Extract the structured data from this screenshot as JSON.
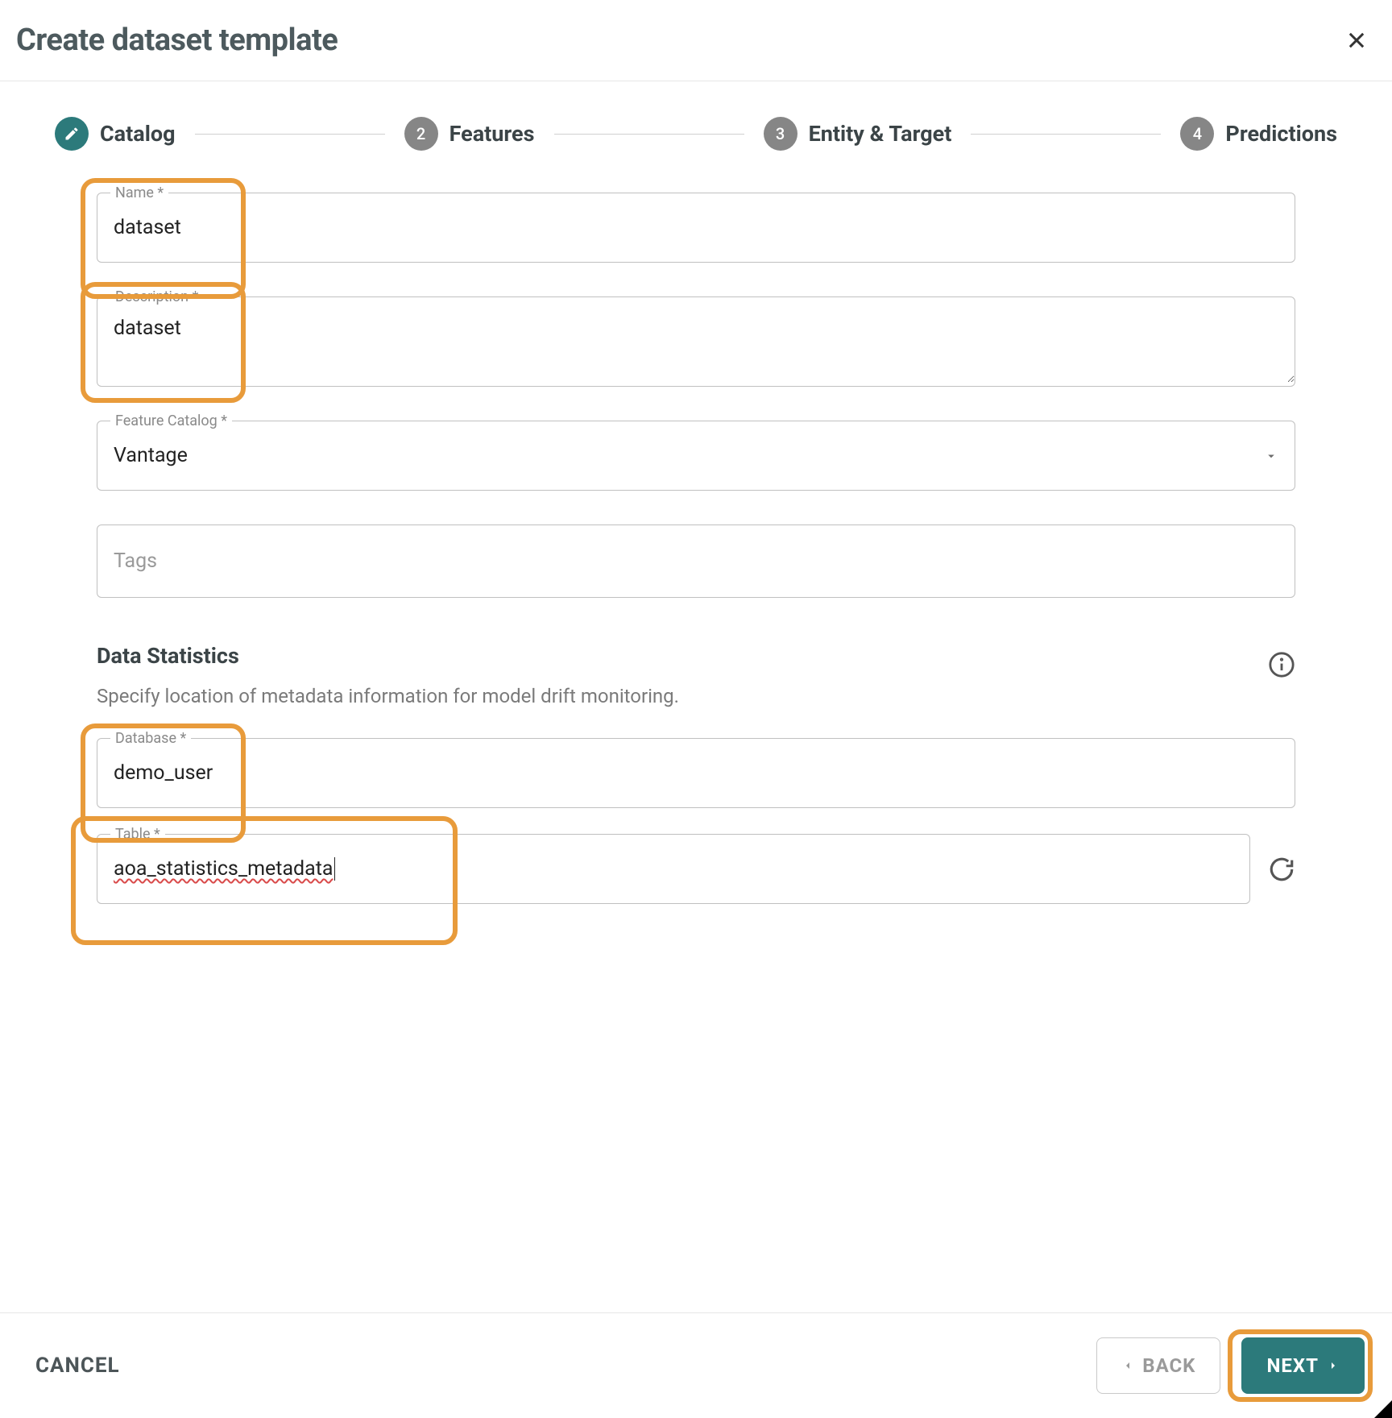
{
  "header": {
    "title": "Create dataset template"
  },
  "stepper": {
    "steps": [
      {
        "label": "Catalog"
      },
      {
        "num": "2",
        "label": "Features"
      },
      {
        "num": "3",
        "label": "Entity & Target"
      },
      {
        "num": "4",
        "label": "Predictions"
      }
    ]
  },
  "form": {
    "name": {
      "label": "Name *",
      "value": "dataset"
    },
    "description": {
      "label": "Description *",
      "value": "dataset"
    },
    "feature_catalog": {
      "label": "Feature Catalog *",
      "value": "Vantage"
    },
    "tags": {
      "placeholder": "Tags"
    }
  },
  "stats": {
    "title": "Data Statistics",
    "desc": "Specify location of metadata information for model drift monitoring.",
    "database": {
      "label": "Database *",
      "value": "demo_user"
    },
    "table": {
      "label": "Table *",
      "value": "aoa_statistics_metadata"
    }
  },
  "footer": {
    "cancel": "CANCEL",
    "back": "BACK",
    "next": "NEXT"
  }
}
